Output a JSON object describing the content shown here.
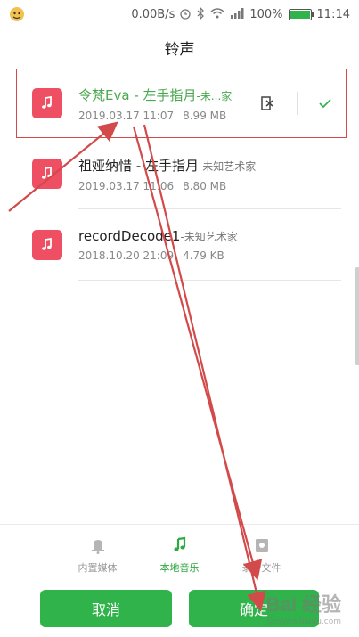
{
  "status": {
    "speed": "0.00B/s",
    "battery": "100%",
    "battery_level": 1.0,
    "time": "11:14",
    "icons": [
      "app-avatar-icon",
      "alarm-icon",
      "bluetooth-icon",
      "wifi-icon",
      "signal-icon",
      "battery-icon"
    ]
  },
  "title": "铃声",
  "rows": [
    {
      "title": "令梵Eva - 左手指月",
      "artist": "-未...家",
      "date": "2019.03.17 11:07",
      "size": "8.99 MB",
      "selected": true
    },
    {
      "title": "祖娅纳惜 - 左手指月",
      "artist": "-未知艺术家",
      "date": "2019.03.17 11:06",
      "size": "8.80 MB",
      "selected": false
    },
    {
      "title": "recordDecode1",
      "artist": "-未知艺术家",
      "date": "2018.10.20 21:09",
      "size": "4.79 KB",
      "selected": false
    }
  ],
  "tabs": [
    {
      "label": "内置媒体",
      "icon": "bell-icon",
      "active": false
    },
    {
      "label": "本地音乐",
      "icon": "music-note-icon",
      "active": true
    },
    {
      "label": "录音文件",
      "icon": "recording-file-icon",
      "active": false
    }
  ],
  "buttons": {
    "cancel": "取消",
    "confirm": "确定"
  },
  "colors": {
    "accent": "#2fb34a",
    "music_tile": "#ef4f62",
    "annotation": "#d24a4a"
  },
  "watermark": {
    "logo": "Bai 经验",
    "url": "jingyan.baidu.com"
  }
}
